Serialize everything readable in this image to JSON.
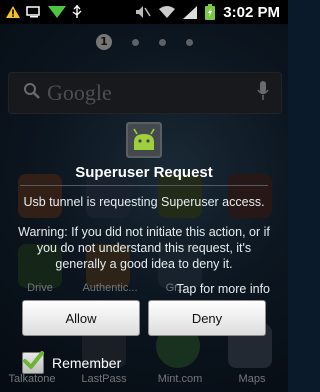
{
  "status_bar": {
    "time": "3:02 PM"
  },
  "home": {
    "page_indicator": "1",
    "search_logo": "Google",
    "apps_row_a": [
      "Drive",
      "Authentic...",
      "Gr..."
    ],
    "apps_row_b": [
      "Talkatone",
      "LastPass",
      "Mint.com",
      "Maps"
    ]
  },
  "dialog": {
    "title": "Superuser Request",
    "message": "Usb tunnel is requesting Superuser access.",
    "warning": "Warning: If you did not initiate this action, or if you do not understand this request, it's generally a good idea to deny it.",
    "more_info": "Tap for more info",
    "allow_label": "Allow",
    "deny_label": "Deny",
    "remember_label": "Remember",
    "remember_checked": true
  },
  "colors": {
    "title": "#ffffff",
    "button_bg": "#f2f2f2",
    "check_green": "#6ab533",
    "battery_green": "#7ac943"
  }
}
